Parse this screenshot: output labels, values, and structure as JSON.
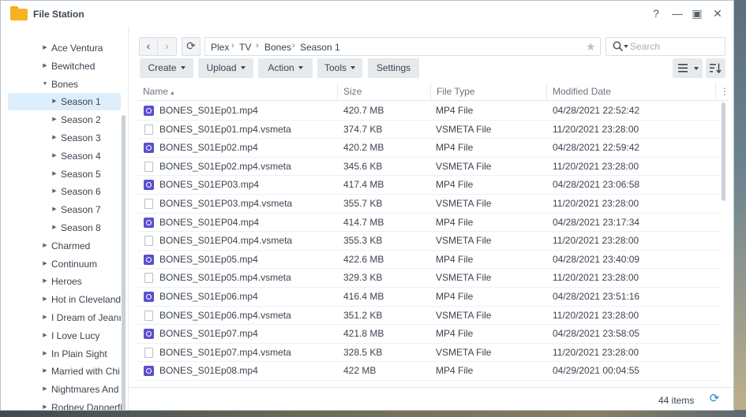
{
  "window": {
    "title": "File Station",
    "controls": {
      "help": "?",
      "minimize": "—",
      "maximize": "▣",
      "close": "✕"
    }
  },
  "sidebar": {
    "items": [
      {
        "label": "Ace Ventura",
        "level": 1,
        "expanded": false
      },
      {
        "label": "Bewitched",
        "level": 1,
        "expanded": false
      },
      {
        "label": "Bones",
        "level": 1,
        "expanded": true
      },
      {
        "label": "Season 1",
        "level": 2,
        "expanded": false,
        "selected": true
      },
      {
        "label": "Season 2",
        "level": 2,
        "expanded": false
      },
      {
        "label": "Season 3",
        "level": 2,
        "expanded": false
      },
      {
        "label": "Season 4",
        "level": 2,
        "expanded": false
      },
      {
        "label": "Season 5",
        "level": 2,
        "expanded": false
      },
      {
        "label": "Season 6",
        "level": 2,
        "expanded": false
      },
      {
        "label": "Season 7",
        "level": 2,
        "expanded": false
      },
      {
        "label": "Season 8",
        "level": 2,
        "expanded": false
      },
      {
        "label": "Charmed",
        "level": 1,
        "expanded": false
      },
      {
        "label": "Continuum",
        "level": 1,
        "expanded": false
      },
      {
        "label": "Heroes",
        "level": 1,
        "expanded": false
      },
      {
        "label": "Hot in Cleveland",
        "level": 1,
        "expanded": false
      },
      {
        "label": "I Dream of Jeanı",
        "level": 1,
        "expanded": false
      },
      {
        "label": "I Love Lucy",
        "level": 1,
        "expanded": false
      },
      {
        "label": "In Plain Sight",
        "level": 1,
        "expanded": false
      },
      {
        "label": "Married with Chi",
        "level": 1,
        "expanded": false
      },
      {
        "label": "Nightmares And",
        "level": 1,
        "expanded": false
      },
      {
        "label": "Rodney Dangerfi",
        "level": 1,
        "expanded": false
      }
    ]
  },
  "nav": {
    "back": "‹",
    "forward": "›",
    "refresh": "⟳"
  },
  "breadcrumb": [
    "Plex",
    "TV",
    "Bones",
    "Season 1"
  ],
  "search": {
    "placeholder": "Search",
    "value": ""
  },
  "toolbar": {
    "create": "Create",
    "upload": "Upload",
    "action": "Action",
    "tools": "Tools",
    "settings": "Settings"
  },
  "table": {
    "columns": [
      "Name",
      "Size",
      "File Type",
      "Modified Date"
    ],
    "sort_indicator": "▴",
    "rows": [
      {
        "name": "BONES_S01Ep01.mp4",
        "size": "420.7 MB",
        "type": "MP4 File",
        "modified": "04/28/2021 22:52:42",
        "icon": "video-file-icon"
      },
      {
        "name": "BONES_S01Ep01.mp4.vsmeta",
        "size": "374.7 KB",
        "type": "VSMETA File",
        "modified": "11/20/2021 23:28:00",
        "icon": "doc-file-icon"
      },
      {
        "name": "BONES_S01Ep02.mp4",
        "size": "420.2 MB",
        "type": "MP4 File",
        "modified": "04/28/2021 22:59:42",
        "icon": "video-file-icon"
      },
      {
        "name": "BONES_S01Ep02.mp4.vsmeta",
        "size": "345.6 KB",
        "type": "VSMETA File",
        "modified": "11/20/2021 23:28:00",
        "icon": "doc-file-icon"
      },
      {
        "name": "BONES_S01EP03.mp4",
        "size": "417.4 MB",
        "type": "MP4 File",
        "modified": "04/28/2021 23:06:58",
        "icon": "video-file-icon"
      },
      {
        "name": "BONES_S01EP03.mp4.vsmeta",
        "size": "355.7 KB",
        "type": "VSMETA File",
        "modified": "11/20/2021 23:28:00",
        "icon": "doc-file-icon"
      },
      {
        "name": "BONES_S01EP04.mp4",
        "size": "414.7 MB",
        "type": "MP4 File",
        "modified": "04/28/2021 23:17:34",
        "icon": "video-file-icon"
      },
      {
        "name": "BONES_S01EP04.mp4.vsmeta",
        "size": "355.3 KB",
        "type": "VSMETA File",
        "modified": "11/20/2021 23:28:00",
        "icon": "doc-file-icon"
      },
      {
        "name": "BONES_S01Ep05.mp4",
        "size": "422.6 MB",
        "type": "MP4 File",
        "modified": "04/28/2021 23:40:09",
        "icon": "video-file-icon"
      },
      {
        "name": "BONES_S01Ep05.mp4.vsmeta",
        "size": "329.3 KB",
        "type": "VSMETA File",
        "modified": "11/20/2021 23:28:00",
        "icon": "doc-file-icon"
      },
      {
        "name": "BONES_S01Ep06.mp4",
        "size": "416.4 MB",
        "type": "MP4 File",
        "modified": "04/28/2021 23:51:16",
        "icon": "video-file-icon"
      },
      {
        "name": "BONES_S01Ep06.mp4.vsmeta",
        "size": "351.2 KB",
        "type": "VSMETA File",
        "modified": "11/20/2021 23:28:00",
        "icon": "doc-file-icon"
      },
      {
        "name": "BONES_S01Ep07.mp4",
        "size": "421.8 MB",
        "type": "MP4 File",
        "modified": "04/28/2021 23:58:05",
        "icon": "video-file-icon"
      },
      {
        "name": "BONES_S01Ep07.mp4.vsmeta",
        "size": "328.5 KB",
        "type": "VSMETA File",
        "modified": "11/20/2021 23:28:00",
        "icon": "doc-file-icon"
      },
      {
        "name": "BONES_S01Ep08.mp4",
        "size": "422 MB",
        "type": "MP4 File",
        "modified": "04/29/2021 00:04:55",
        "icon": "video-file-icon"
      }
    ]
  },
  "footer": {
    "count": "44 items"
  }
}
